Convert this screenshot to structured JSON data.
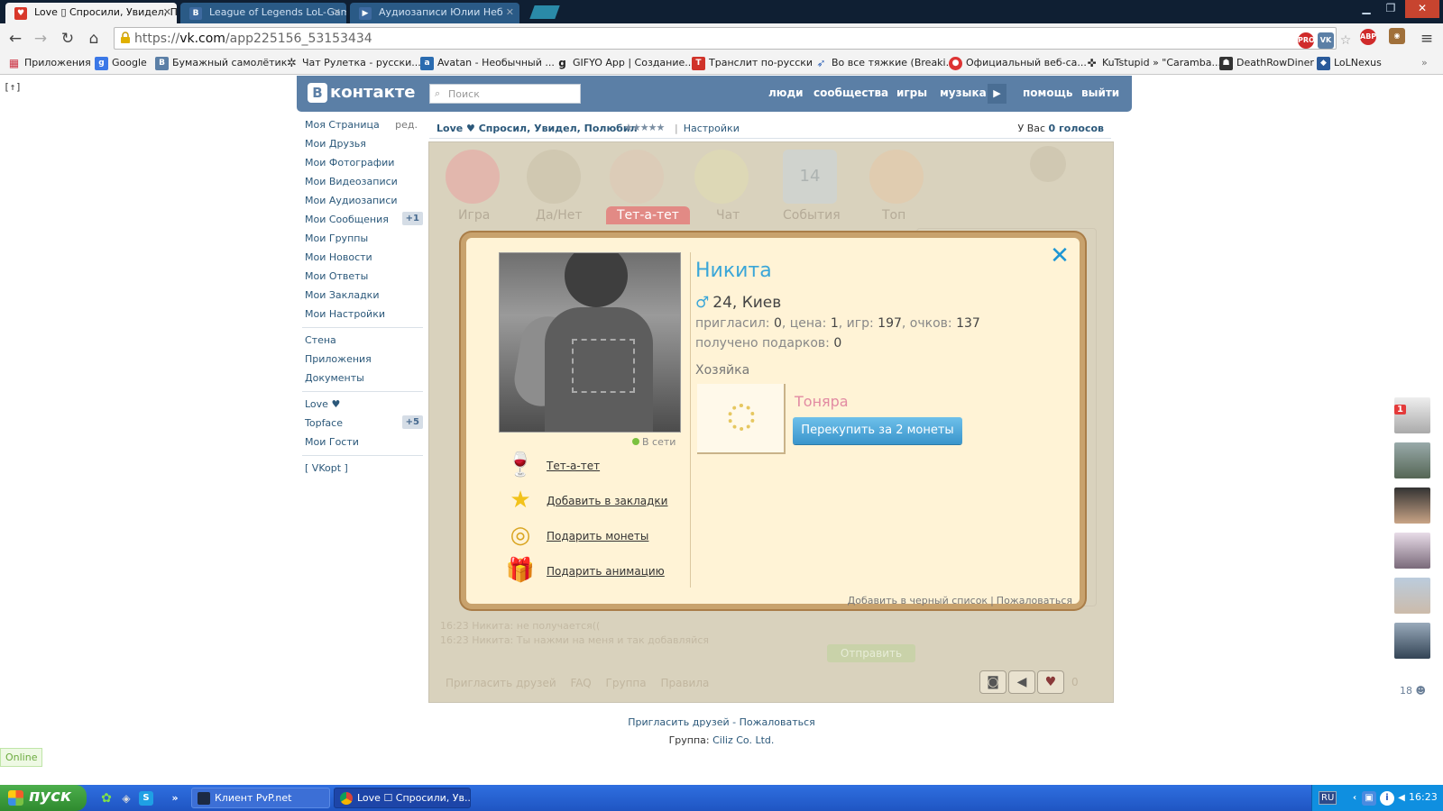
{
  "browser": {
    "tabs": [
      {
        "title": "Love ▯ Спросили, Увидел, По",
        "active": true
      },
      {
        "title": "League of Legends LoL-Gam",
        "active": false
      },
      {
        "title": "Аудиозаписи Юлии Неб",
        "active": false
      }
    ],
    "url_scheme": "https://",
    "url_host": "vk.com",
    "url_path": "/app225156_53153434",
    "extensions": [
      "PRO",
      "VK",
      "ABP"
    ],
    "bookmarks": [
      {
        "label": "Приложения",
        "icon": "apps-grid-icon"
      },
      {
        "label": "Google",
        "icon": "google-icon"
      },
      {
        "label": "Бумажный самолётик",
        "icon": "vk-icon"
      },
      {
        "label": "Чат Рулетка - русски...",
        "icon": "chat-roulette-icon"
      },
      {
        "label": "Avatan - Необычный ...",
        "icon": "avatan-icon"
      },
      {
        "label": "GIFYO App | Создание...",
        "icon": "gifyo-icon"
      },
      {
        "label": "Транслит по-русски",
        "icon": "translit-icon"
      },
      {
        "label": "Во все тяжкие (Breaki...",
        "icon": "breaking-bad-icon"
      },
      {
        "label": "Официальный веб-са...",
        "icon": "pokeball-icon"
      },
      {
        "label": "KuTstupid » \"Caramba...",
        "icon": "kutstupid-icon"
      },
      {
        "label": "DeathRowDiner",
        "icon": "deathrow-icon"
      },
      {
        "label": "LoLNexus",
        "icon": "lolnexus-icon"
      }
    ],
    "bookmarks_more": "»"
  },
  "corner_label": "[↑]",
  "vk": {
    "logo_letter": "B",
    "logo_text": "контакте",
    "search_placeholder": "Поиск",
    "nav": [
      "люди",
      "сообщества",
      "игры",
      "музыка",
      "помощь",
      "выйти"
    ],
    "menu": [
      {
        "label": "Моя Страница",
        "extra": "ред."
      },
      {
        "label": "Мои Друзья"
      },
      {
        "label": "Мои Фотографии"
      },
      {
        "label": "Мои Видеозаписи"
      },
      {
        "label": "Мои Аудиозаписи"
      },
      {
        "label": "Мои Сообщения",
        "count": "+1"
      },
      {
        "label": "Мои Группы"
      },
      {
        "label": "Мои Новости"
      },
      {
        "label": "Мои Ответы"
      },
      {
        "label": "Мои Закладки"
      },
      {
        "label": "Мои Настройки"
      }
    ],
    "menu2": [
      "Стена",
      "Приложения",
      "Документы"
    ],
    "menu3": [
      {
        "label": "Love ♥"
      },
      {
        "label": "Topface",
        "count": "+5"
      },
      {
        "label": "Мои Гости"
      }
    ],
    "menu4": [
      "[ VKopt ]"
    ]
  },
  "app": {
    "title": "Love ♥ Спросил, Увидел, Полюбил",
    "stars": "★★★★★",
    "settings": "Настройки",
    "votes_prefix": "У Вас ",
    "votes_value": "0 голосов"
  },
  "game": {
    "tabs": [
      "Игра",
      "Да/Нет",
      "Тет-а-тет",
      "Чат",
      "События",
      "Топ"
    ],
    "active_tab": "Тет-а-тет",
    "calendar_day": "14",
    "chat_lines": [
      "16:23 Никита: не получается((",
      "16:23 Никита: Ты нажми на меня и так добавляйся"
    ],
    "send_label": "Отправить",
    "footer_links": [
      "Пригласить друзей",
      "FAQ",
      "Группа",
      "Правила"
    ],
    "coins": "0"
  },
  "profile": {
    "name": "Никита",
    "sex_symbol": "♂",
    "age_city": "24, Киев",
    "invited_label": "пригласил: ",
    "invited": "0",
    "price_label": ", цена: ",
    "price": "1",
    "games_label": ", игр: ",
    "games": "197",
    "points_label": ", очков: ",
    "points": "137",
    "gifts_label": "получено подарков: ",
    "gifts": "0",
    "online": "В сети",
    "owner_label": "Хозяйка",
    "owner_name": "Тоняра",
    "buy_button": "Перекупить за 2 монеты",
    "actions": [
      {
        "label": "Тет-а-тет",
        "icon": "wine-glasses-icon"
      },
      {
        "label": "Добавить в закладки",
        "icon": "star-icon"
      },
      {
        "label": "Подарить монеты",
        "icon": "coins-icon"
      },
      {
        "label": "Подарить анимацию",
        "icon": "gift-icon"
      }
    ],
    "blacklist": "Добавить в черный список",
    "report": "Пожаловаться",
    "separator": "|"
  },
  "footer": {
    "invite": "Пригласить друзей",
    "dash": " - ",
    "report": "Пожаловаться",
    "group_label": "Группа: ",
    "group_link": "Ciliz Co. Ltd."
  },
  "online_badge": "Online",
  "right_sidebar": {
    "notification": "1",
    "friends_online": "18"
  },
  "taskbar": {
    "start": "пуск",
    "tasks": [
      "Клиент PvP.net",
      "Love ☐ Спросили, Ув..."
    ],
    "lang": "RU",
    "clock": "16:23"
  }
}
